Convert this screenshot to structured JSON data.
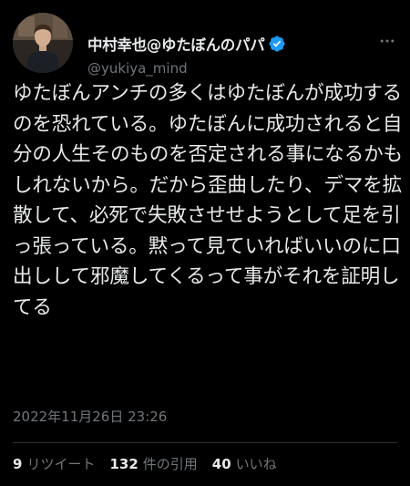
{
  "tweet": {
    "author": {
      "display_name": "中村幸也@ゆたぼんのパパ",
      "handle": "@yukiya_mind",
      "verified": true,
      "avatar_icon": "profile-photo"
    },
    "text": "ゆたぼんアンチの多くはゆたぼんが成功するのを恐れている。ゆたぼんに成功されると自分の人生そのものを否定される事になるかもしれないから。だから歪曲したり、デマを拡散して、必死で失敗させせようとして足を引っ張っている。黙って見ていればいいのに口出しして邪魔してくるって事がそれを証明してる",
    "timestamp": "2022年11月26日 23:26",
    "stats": {
      "retweets": {
        "count": "9",
        "label": "リツイート"
      },
      "quotes": {
        "count": "132",
        "label": "件の引用"
      },
      "likes": {
        "count": "40",
        "label": "いいね"
      }
    },
    "more_icon": "more-horizontal-icon",
    "colors": {
      "background": "#000000",
      "text": "#e7e9ea",
      "secondary": "#71767b",
      "verified": "#1d9bf0",
      "divider": "#2f3336"
    }
  }
}
